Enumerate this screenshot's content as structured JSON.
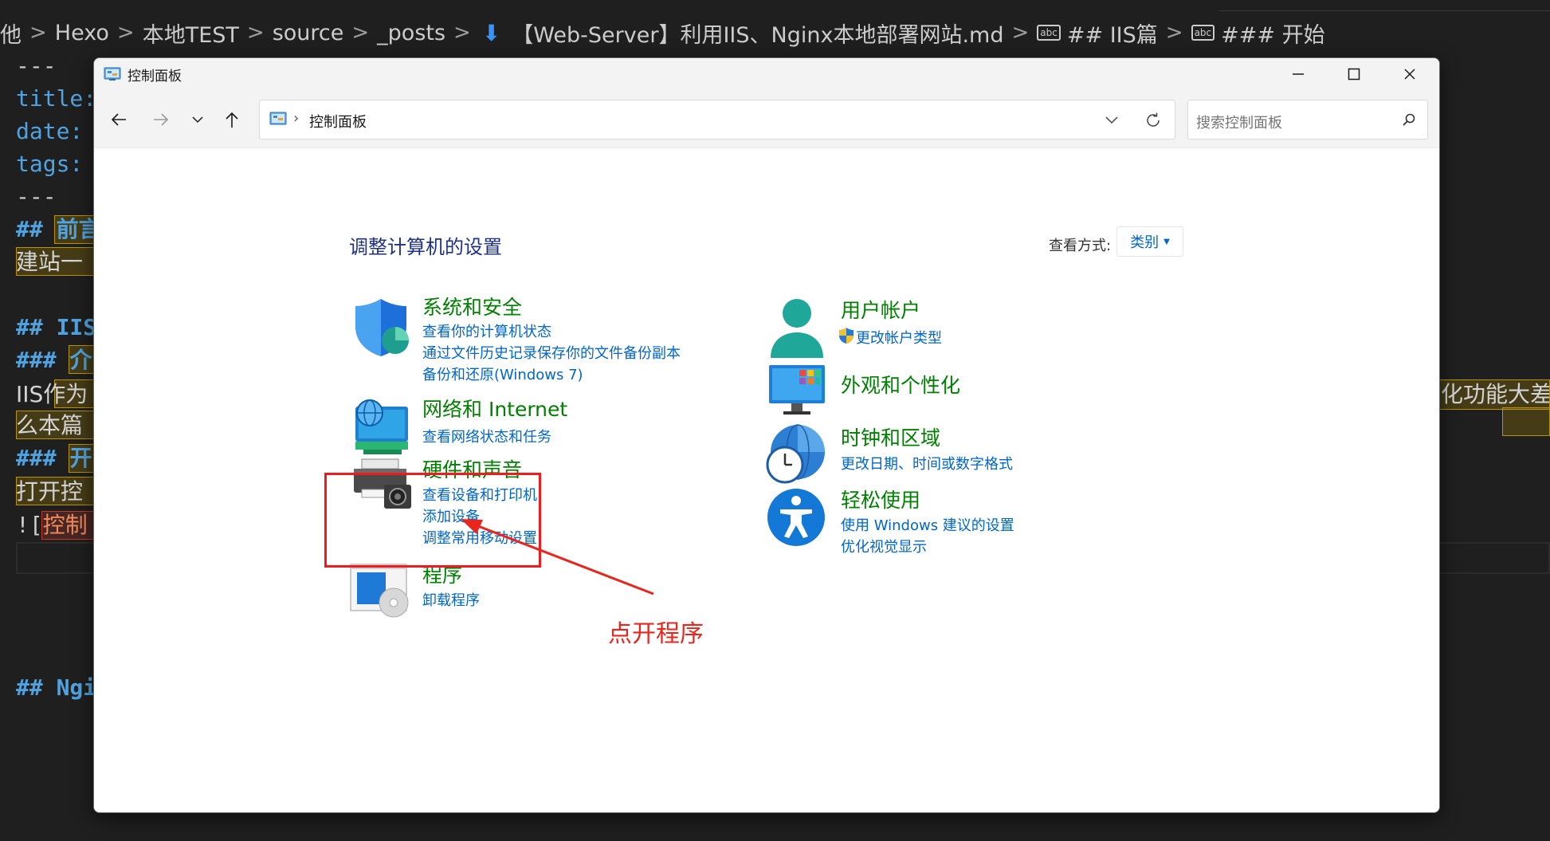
{
  "editor": {
    "breadcrumb": {
      "items": [
        "他",
        "Hexo",
        "本地TEST",
        "source",
        "_posts"
      ],
      "file": "【Web-Server】利用IIS、Nginx本地部署网站.md",
      "symbol1": "## IIS篇",
      "symbol2": "### 开始",
      "sep": ">",
      "abc": "abc"
    },
    "lines": {
      "l1": "---",
      "l2": "title:",
      "l3": "date:",
      "l4": "tags:",
      "l5": "---",
      "l6_prefix": "## ",
      "l6_text": "前言",
      "l7": "建站一",
      "l8_prefix": "## ",
      "l8_text": "IIS",
      "l9_prefix": "### ",
      "l9_text": "介",
      "l10": "IIS作为",
      "l10_right": "化功能大差不",
      "l11": "么本篇",
      "l12_prefix": "### ",
      "l12_text": "开",
      "l13": "打开控",
      "l14_prefix": "![",
      "l14_text": "控制",
      "l15_prefix": "## ",
      "l15_text": "Ngi"
    }
  },
  "window": {
    "title": "控制面板",
    "address": {
      "path": "控制面板",
      "sep": "›"
    },
    "search": {
      "placeholder": "搜索控制面板"
    },
    "heading": "调整计算机的设置",
    "view_by": {
      "label": "查看方式:",
      "value": "类别"
    },
    "categories": {
      "system_security": {
        "title": "系统和安全",
        "links": [
          "查看你的计算机状态",
          "通过文件历史记录保存你的文件备份副本",
          "备份和还原(Windows 7)"
        ]
      },
      "network": {
        "title": "网络和 Internet",
        "links": [
          "查看网络状态和任务"
        ]
      },
      "hardware": {
        "title": "硬件和声音",
        "links": [
          "查看设备和打印机",
          "添加设备",
          "调整常用移动设置"
        ]
      },
      "programs": {
        "title": "程序",
        "links": [
          "卸载程序"
        ]
      },
      "user_accounts": {
        "title": "用户帐户",
        "links": [
          "更改帐户类型"
        ]
      },
      "appearance": {
        "title": "外观和个性化",
        "links": []
      },
      "clock": {
        "title": "时钟和区域",
        "links": [
          "更改日期、时间或数字格式"
        ]
      },
      "ease": {
        "title": "轻松使用",
        "links": [
          "使用 Windows 建议的设置",
          "优化视觉显示"
        ]
      }
    }
  },
  "annotation": {
    "text": "点开程序",
    "color": "#e8261e"
  },
  "colors": {
    "category_title": "#008000",
    "link": "#0066cc",
    "heading": "#1e3287",
    "editor_bg": "#1f1f1f"
  }
}
